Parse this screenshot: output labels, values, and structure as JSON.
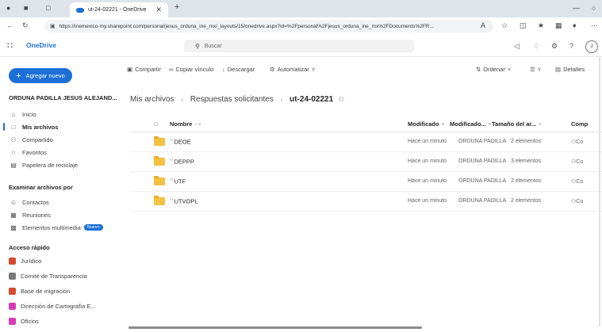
{
  "browser": {
    "tab_title": "ut-24-02221 - OneDrive",
    "url": "https://inemexico-my.sharepoint.com/personal/jesus_orduna_ine_mx/_layouts/15/onedrive.aspx?id=%2Fpersonal%2Fjesus_orduna_ine_mx%2FDocuments%2FR..."
  },
  "suite": {
    "app_name": "OneDrive",
    "search_placeholder": "Buscar",
    "avatar_initial": "J"
  },
  "sidebar": {
    "new_button": "Agregar nuevo",
    "user_name": "ORDUNA PADILLA JESUS ALEJAND...",
    "nav": [
      {
        "label": "Inicio",
        "icon": "home-icon"
      },
      {
        "label": "Mis archivos",
        "icon": "folder-icon"
      },
      {
        "label": "Compartido",
        "icon": "people-icon"
      },
      {
        "label": "Favoritos",
        "icon": "star-icon"
      },
      {
        "label": "Papelera de reciclaje",
        "icon": "trash-icon"
      }
    ],
    "browse_header": "Examinar archivos por",
    "browse": [
      {
        "label": "Contactos",
        "icon": "person-icon"
      },
      {
        "label": "Reuniones",
        "icon": "calendar-icon"
      },
      {
        "label": "Elementos multimedia",
        "icon": "image-icon",
        "badge": "Nuevo"
      }
    ],
    "quick_header": "Acceso rápido",
    "quick": [
      {
        "label": "Jurídico",
        "color": "#d64a2f"
      },
      {
        "label": "Comité de Transparencia",
        "color": "#7a7a7a"
      },
      {
        "label": "Base de migración",
        "color": "#d64a2f"
      },
      {
        "label": "Dirección de Cartografía E...",
        "color": "#d63bb7"
      },
      {
        "label": "Oficios",
        "color": "#d63bb7"
      }
    ]
  },
  "toolbar": {
    "share": "Compartir",
    "copy_link": "Copiar vínculo",
    "download": "Descargar",
    "automate": "Automatizar",
    "sort": "Ordenar",
    "details": "Detalles"
  },
  "breadcrumb": {
    "root": "Mis archivos",
    "parent": "Respuestas solicitantes",
    "current": "ut-24-02221"
  },
  "table": {
    "headers": {
      "name": "Nombre",
      "modified": "Modificado",
      "modified_by": "Modificado...",
      "size": "Tamaño del ar...",
      "sharing": "Comp"
    },
    "rows": [
      {
        "name": "DEOE",
        "modified": "Hace un minuto",
        "modified_by": "ORDUNA PADILLA",
        "size": "2 elementos",
        "sharing": "Co"
      },
      {
        "name": "DEPPP",
        "modified": "Hace un minuto",
        "modified_by": "ORDUNA PADILLA",
        "size": "3 elementos",
        "sharing": "Co"
      },
      {
        "name": "UTF",
        "modified": "Hace un minuto",
        "modified_by": "ORDUNA PADILLA",
        "size": "2 elementos",
        "sharing": "Co"
      },
      {
        "name": "UTVOPL",
        "modified": "Hace un minuto",
        "modified_by": "ORDUNA PADILLA",
        "size": "2 elementos",
        "sharing": "Co"
      }
    ]
  },
  "colors": {
    "accent": "#1c6fd6",
    "folder": "#f5c142"
  }
}
